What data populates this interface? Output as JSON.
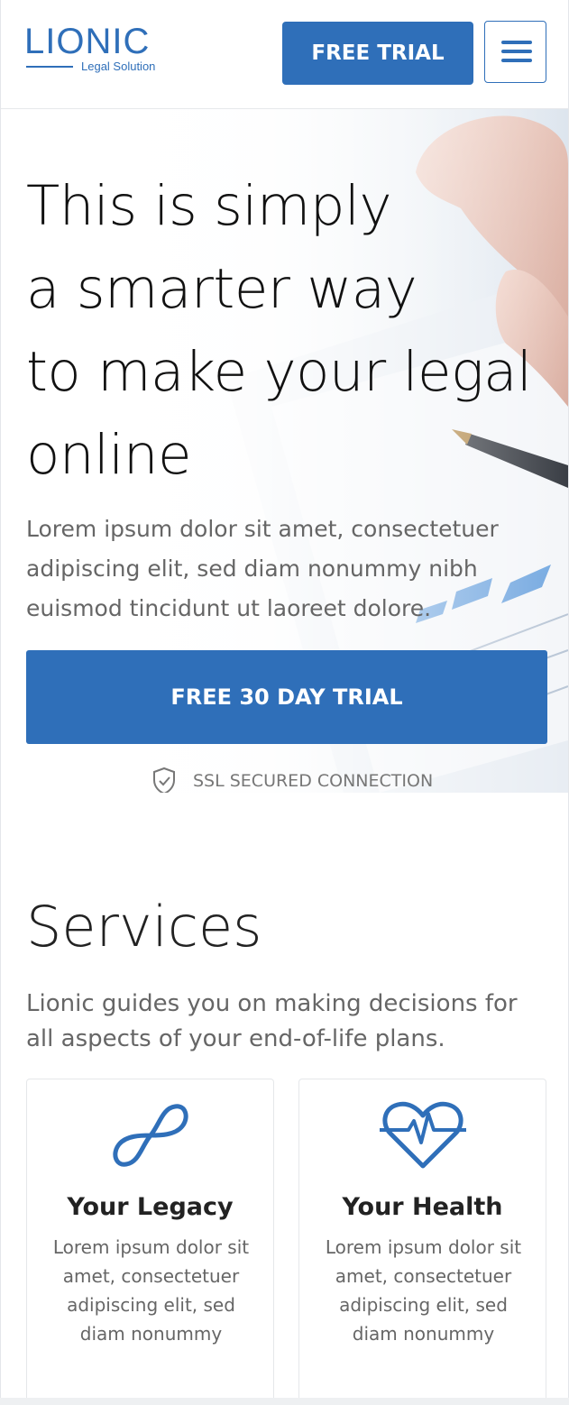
{
  "header": {
    "logo_word": "LIONIC",
    "logo_sub": "Legal Solution",
    "trial_label": "FREE TRIAL",
    "menu_icon": "hamburger-menu-icon"
  },
  "hero": {
    "title_lines": [
      "This is simply",
      "a smarter way",
      "to make your legal",
      "online"
    ],
    "text": "Lorem ipsum dolor sit amet, consectetuer adipiscing elit, sed diam nonummy nibh euismod tincidunt ut laoreet dolore.",
    "cta_label": "FREE 30 DAY TRIAL",
    "ssl_label": "SSL SECURED CONNECTION",
    "ssl_icon": "shield-check-icon"
  },
  "services": {
    "title": "Services",
    "subtitle": "Lionic guides you on making decisions for all aspects of your end-of-life plans.",
    "cards": [
      {
        "icon": "infinity-icon",
        "title": "Your Legacy",
        "text": "Lorem ipsum dolor sit amet, consectetuer adipiscing elit, sed diam nonummy"
      },
      {
        "icon": "heart-pulse-icon",
        "title": "Your Health",
        "text": "Lorem ipsum dolor sit amet, consectetuer adipiscing elit, sed diam nonummy"
      }
    ]
  },
  "colors": {
    "accent": "#2f6fb9",
    "text_muted": "#666666",
    "text_dark": "#222222"
  }
}
